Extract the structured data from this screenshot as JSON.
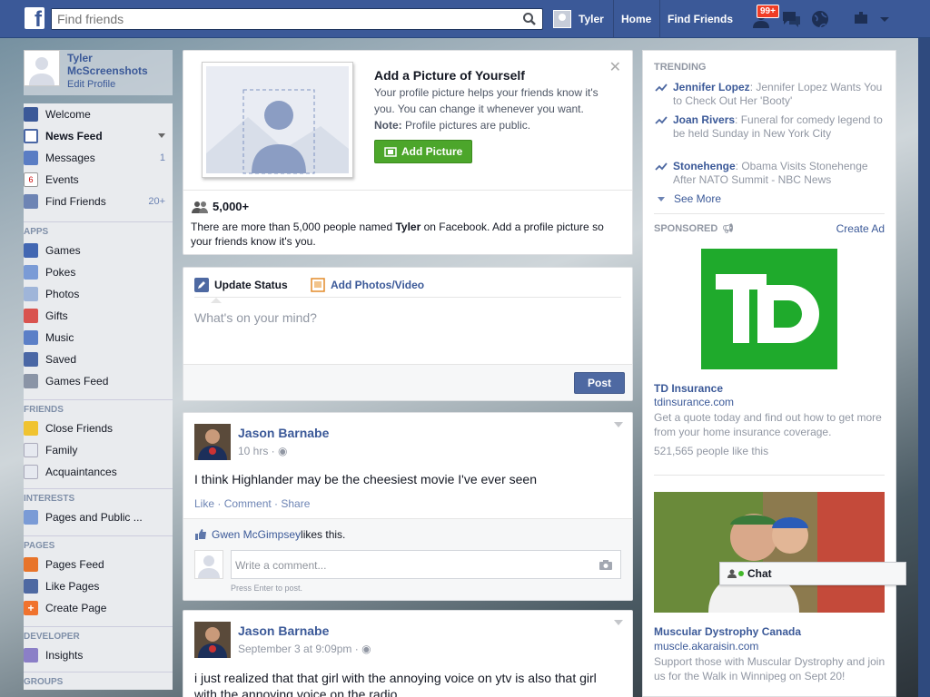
{
  "topbar": {
    "logo": "f",
    "search_placeholder": "Find friends",
    "user_name": "Tyler",
    "home": "Home",
    "find_friends": "Find Friends",
    "friend_requests_badge": "99+"
  },
  "left": {
    "profile_name": "Tyler McScreenshots",
    "edit_profile": "Edit Profile",
    "favorites": [
      {
        "label": "Welcome",
        "icon": "welcome-icon",
        "count": ""
      },
      {
        "label": "News Feed",
        "icon": "news-feed-icon",
        "count": ""
      },
      {
        "label": "Messages",
        "icon": "messages-icon",
        "count": "1"
      },
      {
        "label": "Events",
        "icon": "events-icon",
        "count": ""
      },
      {
        "label": "Find Friends",
        "icon": "find-friends-icon",
        "count": "20+"
      }
    ],
    "apps_title": "APPS",
    "apps": [
      {
        "label": "Games"
      },
      {
        "label": "Pokes"
      },
      {
        "label": "Photos"
      },
      {
        "label": "Gifts"
      },
      {
        "label": "Music"
      },
      {
        "label": "Saved"
      },
      {
        "label": "Games Feed"
      }
    ],
    "friends_title": "FRIENDS",
    "friends": [
      {
        "label": "Close Friends"
      },
      {
        "label": "Family"
      },
      {
        "label": "Acquaintances"
      }
    ],
    "interests_title": "INTERESTS",
    "interests": [
      {
        "label": "Pages and Public ..."
      }
    ],
    "pages_title": "PAGES",
    "pages": [
      {
        "label": "Pages Feed"
      },
      {
        "label": "Like Pages"
      },
      {
        "label": "Create Page"
      }
    ],
    "developer_title": "DEVELOPER",
    "developer": [
      {
        "label": "Insights"
      }
    ],
    "groups_title": "GROUPS"
  },
  "profile_prompt": {
    "title": "Add a Picture of Yourself",
    "body": "Your profile picture helps your friends know it's you. You can change it whenever you want.",
    "note_label": "Note:",
    "note_text": " Profile pictures are public.",
    "button": "Add Picture",
    "count": "5,000+",
    "count_text_a": "There are more than 5,000 people named ",
    "count_name": "Tyler",
    "count_text_b": " on Facebook. Add a profile picture so your friends know it's you."
  },
  "composer": {
    "tab_status": "Update Status",
    "tab_photos": "Add Photos/Video",
    "placeholder": "What's on your mind?",
    "post_button": "Post"
  },
  "posts": [
    {
      "author": "Jason Barnabe",
      "time": "10 hrs · ",
      "text": "I think Highlander may be the cheesiest movie I've ever seen",
      "like": "Like",
      "comment": "Comment",
      "share": "Share",
      "liker": "Gwen McGimpsey",
      "likes_suffix": " likes this.",
      "comment_placeholder": "Write a comment...",
      "press_enter": "Press Enter to post."
    },
    {
      "author": "Jason Barnabe",
      "time": "September 3 at 9:09pm · ",
      "text": "i just realized that that girl with the annoying voice on ytv is also that girl with the annoying voice on the radio"
    }
  ],
  "trending": {
    "title": "TRENDING",
    "items": [
      {
        "name": "Jennifer Lopez",
        "text": ": Jennifer Lopez Wants You to Check Out Her 'Booty'"
      },
      {
        "name": "Joan Rivers",
        "text": ": Funeral for comedy legend to be held Sunday in New York City"
      },
      {
        "name": "Stonehenge",
        "text": ": Obama Visits Stonehenge After NATO Summit - NBC News"
      }
    ],
    "see_more": "See More"
  },
  "sponsored": {
    "title": "SPONSORED",
    "create_ad": "Create Ad",
    "ads": [
      {
        "logo_text": "TD",
        "name": "TD Insurance",
        "url": "tdinsurance.com",
        "desc": "Get a quote today and find out how to get more from your home insurance coverage.",
        "likes": "521,565 people like this"
      },
      {
        "name": "Muscular Dystrophy Canada",
        "url": "muscle.akaraisin.com",
        "desc": "Support those with Muscular Dystrophy and join us for the Walk in Winnipeg on Sept 20!"
      }
    ]
  },
  "chat": {
    "label": "Chat"
  },
  "colors": {
    "brand": "#3b5998",
    "green": "#4ca62b",
    "td_green": "#1faa2c"
  }
}
